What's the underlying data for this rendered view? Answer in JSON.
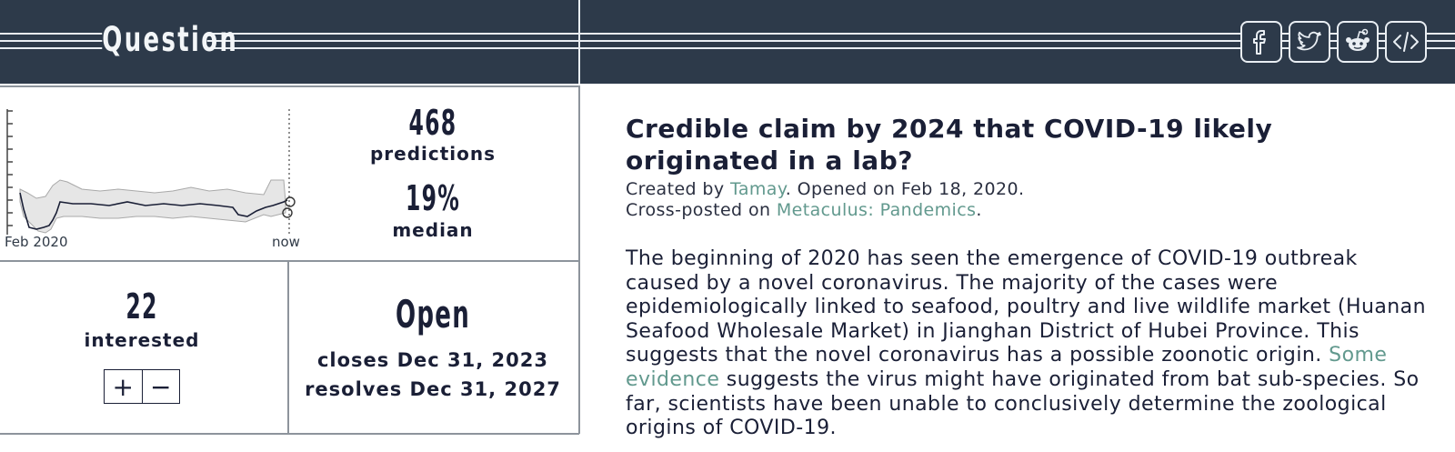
{
  "header": {
    "title": "Question",
    "share_buttons": [
      {
        "name": "facebook-share-button",
        "icon": "facebook-icon"
      },
      {
        "name": "twitter-share-button",
        "icon": "twitter-icon"
      },
      {
        "name": "reddit-share-button",
        "icon": "reddit-icon"
      },
      {
        "name": "embed-share-button",
        "icon": "code-icon"
      }
    ]
  },
  "chart": {
    "x_start_label": "Feb 2020",
    "x_end_label": "now"
  },
  "stats": {
    "predictions_count": "468",
    "predictions_label": "predictions",
    "median_value": "19%",
    "median_label": "median",
    "interested_count": "22",
    "interested_label": "interested",
    "vote_up": "+",
    "vote_down": "−",
    "status": "Open",
    "closes": "closes Dec 31, 2023",
    "resolves": "resolves Dec 31, 2027"
  },
  "question": {
    "title": "Credible claim by 2024 that COVID-19 likely originated in a lab?",
    "created_prefix": "Created by ",
    "author": "Tamay",
    "opened": ". Opened on Feb 18, 2020.",
    "crosspost_prefix": "Cross-posted on ",
    "crosspost_link": "Metaculus: Pandemics",
    "crosspost_suffix": ".",
    "body_part1": "The beginning of 2020 has seen the emergence of COVID-19 outbreak caused by a novel coronavirus. The majority of the cases were epidemiologically linked to seafood, poultry and live wildlife market (Huanan Seafood Wholesale Market) in Jianghan District of Hubei Province. This suggests that the novel coronavirus has a possible zoonotic origin. ",
    "body_link": "Some evidence",
    "body_part2": " suggests the virus might have originated from bat sub-species. So far, scientists have been unable to conclusively determine the zoological origins of COVID-19."
  },
  "colors": {
    "header_bg": "#2d3a4a",
    "header_lines": "#e9eef3",
    "text": "#1a1f36",
    "link": "#62998e",
    "band": "#e6e6e6"
  }
}
